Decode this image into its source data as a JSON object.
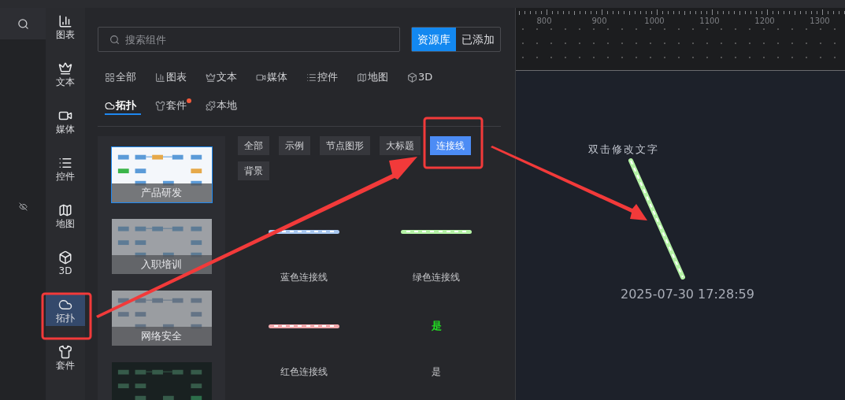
{
  "rail": [
    {
      "label": "图表",
      "selected": false
    },
    {
      "label": "文本",
      "selected": false
    },
    {
      "label": "媒体",
      "selected": false
    },
    {
      "label": "控件",
      "selected": false
    },
    {
      "label": "地图",
      "selected": false
    },
    {
      "label": "3D",
      "selected": false
    },
    {
      "label": "拓扑",
      "selected": true
    },
    {
      "label": "套件",
      "selected": false
    }
  ],
  "search": {
    "placeholder": "搜索组件"
  },
  "source_toggle": [
    {
      "label": "资源库",
      "selected": true
    },
    {
      "label": "已添加",
      "selected": false
    }
  ],
  "categories": [
    {
      "label": "全部",
      "selected": false,
      "badge": false
    },
    {
      "label": "图表",
      "selected": false,
      "badge": false
    },
    {
      "label": "文本",
      "selected": false,
      "badge": false
    },
    {
      "label": "媒体",
      "selected": false,
      "badge": false
    },
    {
      "label": "控件",
      "selected": false,
      "badge": false
    },
    {
      "label": "地图",
      "selected": false,
      "badge": false
    },
    {
      "label": "3D",
      "selected": false,
      "badge": false
    },
    {
      "label": "拓扑",
      "selected": true,
      "badge": false
    },
    {
      "label": "套件",
      "selected": false,
      "badge": true
    },
    {
      "label": "本地",
      "selected": false,
      "badge": false
    }
  ],
  "templates": [
    {
      "caption": "产品研发",
      "selected": true
    },
    {
      "caption": "入职培训",
      "selected": false
    },
    {
      "caption": "网络安全",
      "selected": false
    },
    {
      "selected": false
    }
  ],
  "filters": [
    {
      "label": "全部",
      "selected": false
    },
    {
      "label": "示例",
      "selected": false
    },
    {
      "label": "节点图形",
      "selected": false
    },
    {
      "label": "大标题",
      "selected": false
    },
    {
      "label": "连接线",
      "selected": true
    },
    {
      "label": "背景",
      "selected": false
    }
  ],
  "component_rows": [
    {
      "previews": [
        {
          "kind": "line",
          "color": "#a9c8f0"
        },
        {
          "kind": "line",
          "color": "#b5f2a6"
        }
      ],
      "labels": [
        "蓝色连接线",
        "绿色连接线"
      ]
    },
    {
      "previews": [
        {
          "kind": "line",
          "color": "#f0a8ab"
        },
        {
          "kind": "text",
          "sample": "是",
          "color": "#22dd22"
        }
      ],
      "labels": [
        "红色连接线",
        "是"
      ]
    }
  ],
  "ruler": {
    "labels": [
      "800",
      "900",
      "1000",
      "1100",
      "1200",
      "1300"
    ]
  },
  "canvas": {
    "text": "双击修改文字",
    "timestamp": "2025-07-30 17:28:59"
  }
}
